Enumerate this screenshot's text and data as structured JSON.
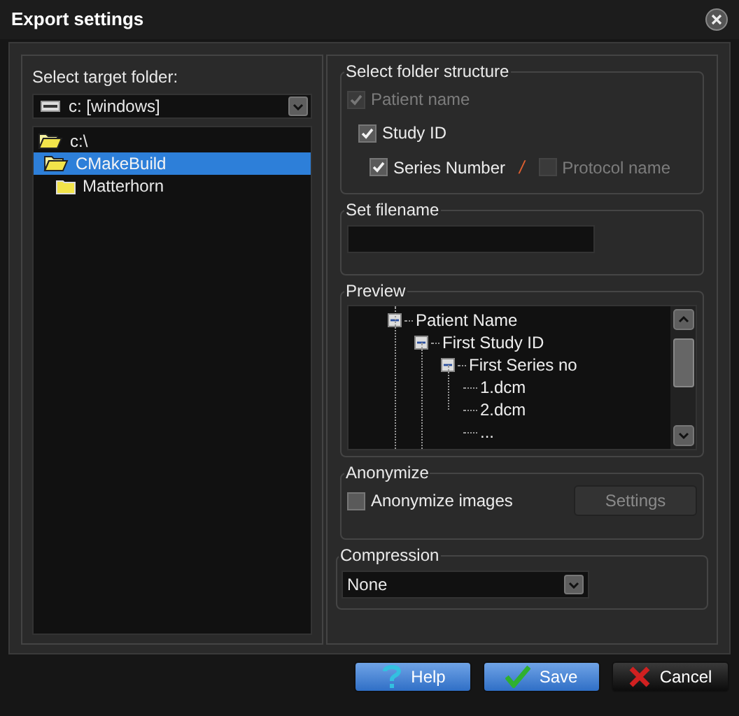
{
  "window": {
    "title": "Export settings"
  },
  "target_folder": {
    "label": "Select target folder:",
    "drive": "c: [windows]",
    "tree": [
      {
        "label": "c:\\",
        "expanded": true,
        "selected": false,
        "children": [
          {
            "label": "CMakeBuild",
            "expanded": true,
            "selected": true,
            "children": [
              {
                "label": "Matterhorn",
                "expanded": false,
                "selected": false
              }
            ]
          }
        ]
      }
    ]
  },
  "folder_structure": {
    "title": "Select folder structure",
    "options": [
      {
        "label": "Patient name",
        "checked": true,
        "disabled": true
      },
      {
        "label": "Study ID",
        "checked": true,
        "disabled": false
      },
      {
        "label": "Series Number",
        "checked": true,
        "disabled": false
      },
      {
        "label": "Protocol name",
        "checked": false,
        "disabled": true
      }
    ],
    "separator": "/"
  },
  "filename": {
    "title": "Set filename"
  },
  "preview": {
    "title": "Preview",
    "tree": [
      {
        "label": "Patient Name",
        "expanded": true,
        "children": [
          {
            "label": "First Study ID",
            "expanded": true,
            "children": [
              {
                "label": "First Series no",
                "expanded": true,
                "children": [
                  {
                    "label": "1.dcm"
                  },
                  {
                    "label": "2.dcm"
                  },
                  {
                    "label": "..."
                  }
                ]
              }
            ]
          }
        ]
      }
    ]
  },
  "anonymize": {
    "title": "Anonymize",
    "option": {
      "label": "Anonymize images",
      "checked": false,
      "disabled": false
    },
    "settings_button": {
      "label": "Settings",
      "disabled": true
    }
  },
  "compression": {
    "title": "Compression",
    "value": "None"
  },
  "buttons": [
    {
      "kind": "help",
      "label": "Help"
    },
    {
      "kind": "save",
      "label": "Save"
    },
    {
      "kind": "cancel",
      "label": "Cancel"
    }
  ]
}
